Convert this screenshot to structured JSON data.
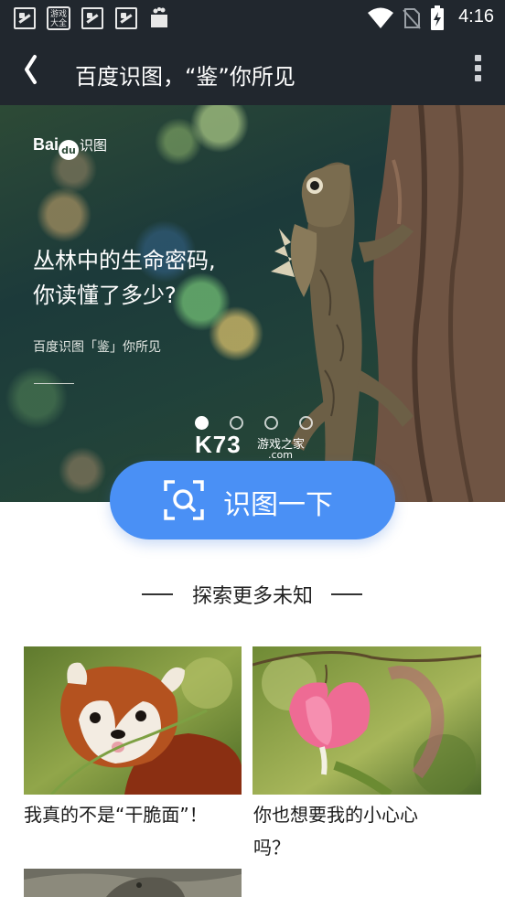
{
  "status_bar": {
    "time": "4:16",
    "icons": [
      "app-notification-icon",
      "game-store-icon",
      "app-notification-icon",
      "app-notification-icon",
      "shopping-bag-icon",
      "wifi-icon",
      "no-sim-icon",
      "battery-charging-icon"
    ],
    "game_icon_text_1": "游戏",
    "game_icon_text_2": "大全"
  },
  "app_bar": {
    "back_icon": "chevron-left-icon",
    "title": "百度识图，“鉴”你所见",
    "more_icon": "more-vertical-icon"
  },
  "banner": {
    "logo_text": "Bai",
    "logo_text_2": "du",
    "logo_suffix": "识图",
    "heading_line_1": "丛林中的生命密码,",
    "heading_line_2": "你读懂了多少?",
    "subtitle": "百度识图「鉴」你所见",
    "carousel": {
      "count": 4,
      "active": 0
    },
    "watermark_main": "K73",
    "watermark_name": "游戏之家",
    "watermark_domain": ".com"
  },
  "recognize_button": {
    "icon": "scan-camera-icon",
    "label": "识图一下"
  },
  "explore": {
    "title": "探索更多未知"
  },
  "cards": [
    {
      "image": "red-panda-photo",
      "title": "我真的不是“干脆面”！"
    },
    {
      "image": "bleeding-heart-flower-photo",
      "title_line_1": "你也想要我的小心心",
      "title_line_2": "吗？"
    },
    {
      "image": "lizard-photo"
    }
  ],
  "colors": {
    "toolbar_bg": "#21272e",
    "accent_blue": "#4a90f5",
    "page_bg": "#ffffff"
  }
}
